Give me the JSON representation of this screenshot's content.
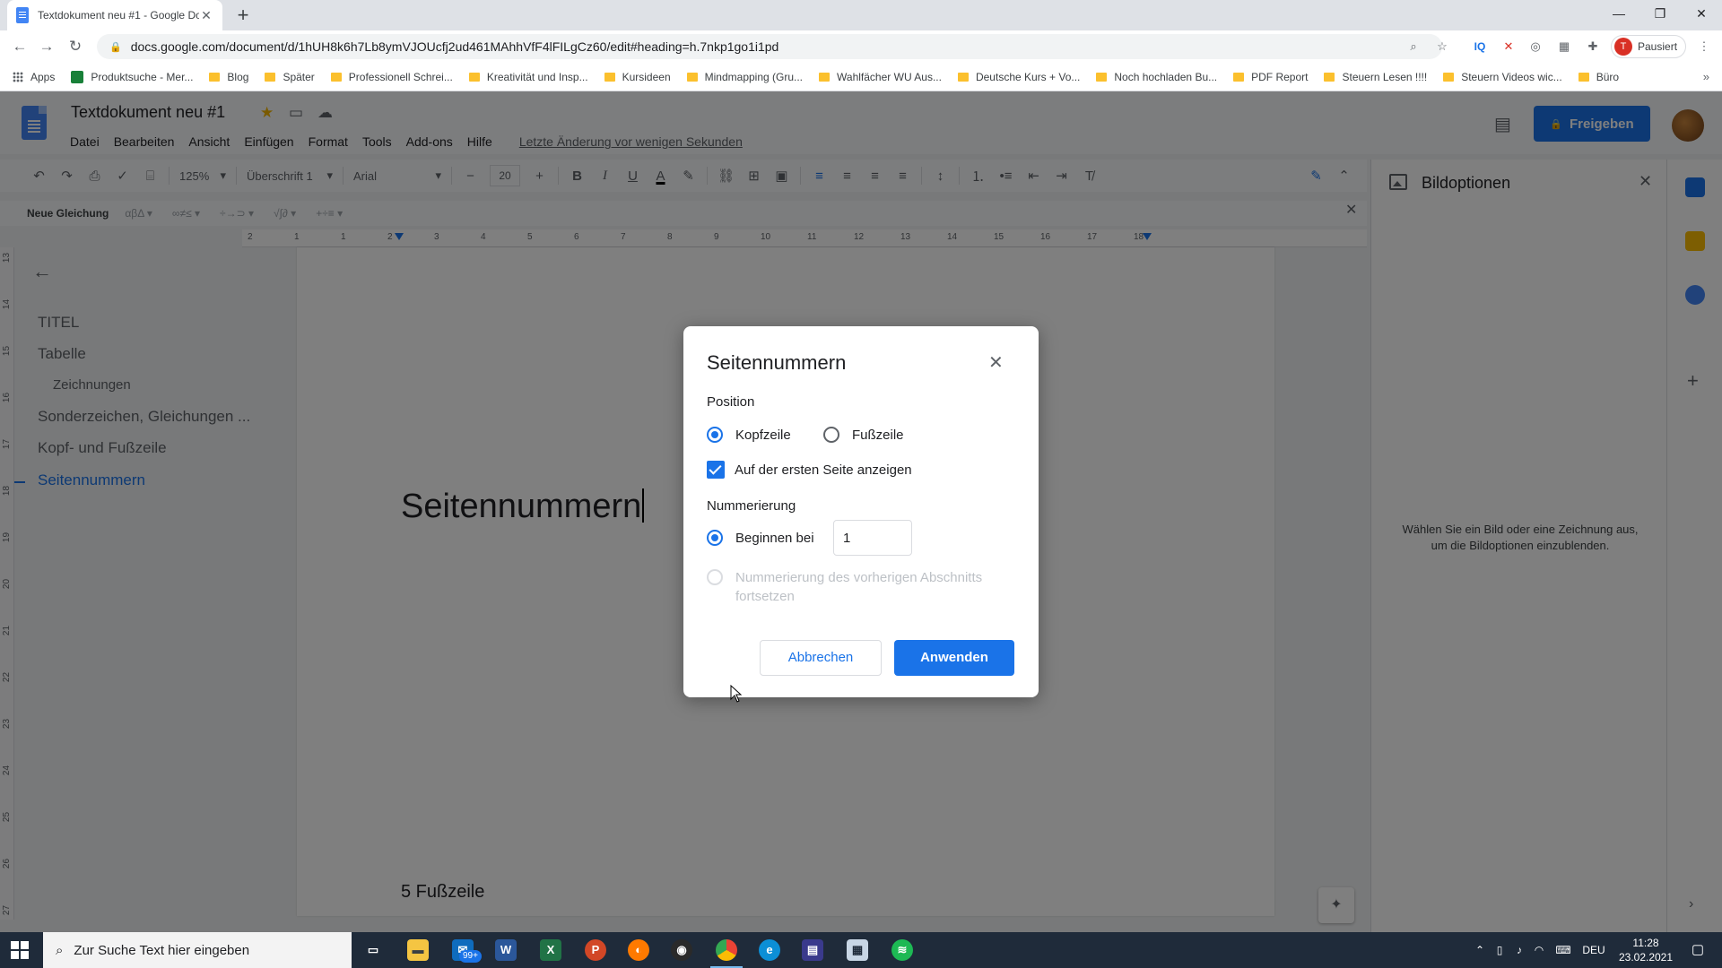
{
  "browser": {
    "tab_title": "Textdokument neu #1 - Google Docs",
    "url": "docs.google.com/document/d/1hUH8k6h7Lb8ymVJOUcfj2ud461MAhhVfF4lFILgCz60/edit#heading=h.7nkp1go1i1pd",
    "profile_label": "Pausiert",
    "profile_initial": "T",
    "bookmarks": [
      {
        "label": "Apps",
        "icon": "apps-grid-icon"
      },
      {
        "label": "Produktsuche - Mer...",
        "icon": "green-square-icon"
      },
      {
        "label": "Blog",
        "icon": "folder-icon"
      },
      {
        "label": "Später",
        "icon": "folder-icon"
      },
      {
        "label": "Professionell Schrei...",
        "icon": "folder-icon"
      },
      {
        "label": "Kreativität und Insp...",
        "icon": "folder-icon"
      },
      {
        "label": "Kursideen",
        "icon": "folder-icon"
      },
      {
        "label": "Mindmapping (Gru...",
        "icon": "folder-icon"
      },
      {
        "label": "Wahlfächer WU Aus...",
        "icon": "folder-icon"
      },
      {
        "label": "Deutsche Kurs + Vo...",
        "icon": "folder-icon"
      },
      {
        "label": "Noch hochladen Bu...",
        "icon": "folder-icon"
      },
      {
        "label": "PDF Report",
        "icon": "folder-icon"
      },
      {
        "label": "Steuern Lesen !!!!",
        "icon": "folder-icon"
      },
      {
        "label": "Steuern Videos wic...",
        "icon": "folder-icon"
      },
      {
        "label": "Büro",
        "icon": "folder-icon"
      }
    ]
  },
  "docs": {
    "title": "Textdokument neu #1",
    "menu": [
      "Datei",
      "Bearbeiten",
      "Ansicht",
      "Einfügen",
      "Format",
      "Tools",
      "Add-ons",
      "Hilfe"
    ],
    "last_edit": "Letzte Änderung vor wenigen Sekunden",
    "share_label": "Freigeben",
    "toolbar": {
      "zoom": "125%",
      "style": "Überschrift 1",
      "font": "Arial",
      "font_size": "20"
    },
    "equation_bar": {
      "label": "Neue Gleichung",
      "symbols": [
        "αβΔ ▾",
        "∞≠≤ ▾",
        "÷→⊃ ▾",
        "√∫∂ ▾",
        "+÷≡ ▾"
      ]
    },
    "ruler_ticks": [
      "2",
      "1",
      "1",
      "2",
      "3",
      "4",
      "5",
      "6",
      "7",
      "8",
      "9",
      "10",
      "11",
      "12",
      "13",
      "14",
      "15",
      "16",
      "17",
      "18"
    ],
    "vruler_ticks": [
      "13",
      "14",
      "15",
      "16",
      "17",
      "18",
      "19",
      "20",
      "21",
      "22",
      "23",
      "24",
      "25",
      "26",
      "27"
    ],
    "outline": [
      {
        "label": "TITEL",
        "level": 1,
        "active": false
      },
      {
        "label": "Tabelle",
        "level": 1,
        "active": false
      },
      {
        "label": "Zeichnungen",
        "level": 2,
        "active": false
      },
      {
        "label": "Sonderzeichen, Gleichungen ...",
        "level": 1,
        "active": false
      },
      {
        "label": "Kopf- und Fußzeile",
        "level": 1,
        "active": false
      },
      {
        "label": "Seitennummern",
        "level": 1,
        "active": true
      }
    ],
    "page_heading": "Seitennummern",
    "page_footer": "5 Fußzeile"
  },
  "side_panel": {
    "title": "Bildoptionen",
    "hint": "Wählen Sie ein Bild oder eine Zeichnung aus, um die Bildoptionen einzublenden."
  },
  "dialog": {
    "title": "Seitennummern",
    "position_label": "Position",
    "header_option": "Kopfzeile",
    "footer_option": "Fußzeile",
    "position_selected": "Kopfzeile",
    "show_first_page_label": "Auf der ersten Seite anzeigen",
    "show_first_page_checked": true,
    "numbering_label": "Nummerierung",
    "start_at_label": "Beginnen bei",
    "start_at_value": "1",
    "continue_label": "Nummerierung des vorherigen Abschnitts fortsetzen",
    "cancel_label": "Abbrechen",
    "apply_label": "Anwenden"
  },
  "taskbar": {
    "search_placeholder": "Zur Suche Text hier eingeben",
    "mail_badge": "99+",
    "language": "DEU",
    "time": "11:28",
    "date": "23.02.2021"
  },
  "colors": {
    "accent": "#1a73e8",
    "overlay": "rgba(0,0,0,0.5)",
    "taskbar": "#1f2b3a"
  }
}
